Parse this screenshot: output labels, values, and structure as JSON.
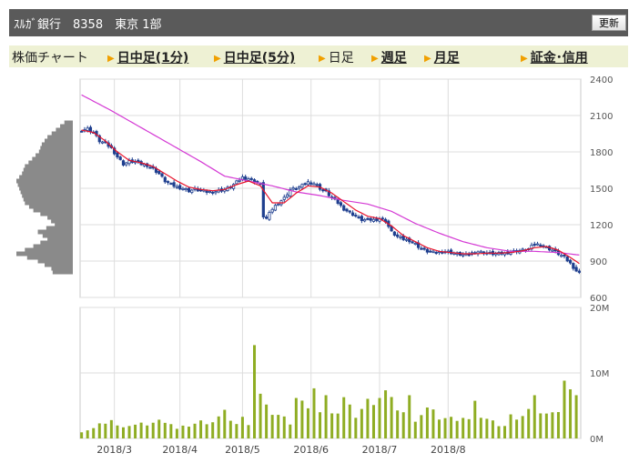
{
  "header": {
    "title": "ｽﾙｶﾞ銀行　8358　東京 1部",
    "refresh_label": "更新"
  },
  "tabs": {
    "chart_label": "株価チャート",
    "items": [
      {
        "label": "日中足(1分)",
        "link": true
      },
      {
        "label": "日中足(5分)",
        "link": true
      },
      {
        "label": "日足",
        "link": false
      },
      {
        "label": "週足",
        "link": true
      },
      {
        "label": "月足",
        "link": true
      },
      {
        "label": "証金･信用",
        "link": true
      }
    ]
  },
  "colors": {
    "candle_up": "#ffffff",
    "candle_down": "#1f3f8f",
    "ma_short": "#e8132b",
    "ma_long": "#d439d4",
    "volume_bar": "#8fad23",
    "volume_profile": "#8a8a8a"
  },
  "chart_data": {
    "type": "candlestick",
    "price_axis": {
      "min": 600,
      "max": 2400,
      "ticks": [
        600,
        900,
        1200,
        1500,
        1800,
        2100,
        2400
      ]
    },
    "volume_axis": {
      "min": 0,
      "max": 20,
      "ticks": [
        "0M",
        "10M",
        "20M"
      ]
    },
    "x_labels": [
      "2018/3",
      "2018/4",
      "2018/5",
      "2018/6",
      "2018/7",
      "2018/8"
    ],
    "price_anchors": [
      [
        0,
        1980
      ],
      [
        2,
        1990
      ],
      [
        4,
        1960
      ],
      [
        6,
        1890
      ],
      [
        8,
        1870
      ],
      [
        10,
        1830
      ],
      [
        12,
        1760
      ],
      [
        14,
        1700
      ],
      [
        16,
        1720
      ],
      [
        18,
        1720
      ],
      [
        20,
        1700
      ],
      [
        22,
        1690
      ],
      [
        24,
        1660
      ],
      [
        26,
        1620
      ],
      [
        28,
        1560
      ],
      [
        30,
        1530
      ],
      [
        32,
        1510
      ],
      [
        34,
        1500
      ],
      [
        36,
        1480
      ],
      [
        38,
        1490
      ],
      [
        40,
        1480
      ],
      [
        42,
        1470
      ],
      [
        44,
        1470
      ],
      [
        46,
        1480
      ],
      [
        48,
        1490
      ],
      [
        50,
        1510
      ],
      [
        52,
        1550
      ],
      [
        54,
        1590
      ],
      [
        56,
        1580
      ],
      [
        58,
        1560
      ],
      [
        60,
        1530
      ],
      [
        61,
        1270
      ],
      [
        62,
        1250
      ],
      [
        64,
        1330
      ],
      [
        66,
        1380
      ],
      [
        68,
        1420
      ],
      [
        70,
        1490
      ],
      [
        72,
        1500
      ],
      [
        74,
        1520
      ],
      [
        76,
        1550
      ],
      [
        78,
        1540
      ],
      [
        80,
        1500
      ],
      [
        82,
        1470
      ],
      [
        84,
        1420
      ],
      [
        86,
        1380
      ],
      [
        88,
        1330
      ],
      [
        90,
        1300
      ],
      [
        92,
        1270
      ],
      [
        94,
        1240
      ],
      [
        96,
        1240
      ],
      [
        98,
        1240
      ],
      [
        100,
        1250
      ],
      [
        102,
        1230
      ],
      [
        104,
        1140
      ],
      [
        106,
        1100
      ],
      [
        108,
        1080
      ],
      [
        110,
        1070
      ],
      [
        112,
        1040
      ],
      [
        114,
        1000
      ],
      [
        116,
        980
      ],
      [
        118,
        970
      ],
      [
        120,
        975
      ],
      [
        122,
        980
      ],
      [
        124,
        970
      ],
      [
        126,
        960
      ],
      [
        128,
        950
      ],
      [
        130,
        950
      ],
      [
        132,
        980
      ],
      [
        134,
        975
      ],
      [
        136,
        965
      ],
      [
        138,
        960
      ],
      [
        140,
        960
      ],
      [
        142,
        965
      ],
      [
        144,
        975
      ],
      [
        146,
        985
      ],
      [
        148,
        990
      ],
      [
        150,
        1000
      ],
      [
        152,
        1040
      ],
      [
        154,
        1035
      ],
      [
        156,
        1010
      ],
      [
        158,
        990
      ],
      [
        160,
        960
      ],
      [
        162,
        930
      ],
      [
        164,
        880
      ],
      [
        166,
        820
      ],
      [
        167,
        800
      ]
    ],
    "ma_short_anchors": [
      [
        0,
        1980
      ],
      [
        4,
        1960
      ],
      [
        8,
        1890
      ],
      [
        12,
        1800
      ],
      [
        16,
        1730
      ],
      [
        20,
        1710
      ],
      [
        24,
        1680
      ],
      [
        28,
        1620
      ],
      [
        32,
        1560
      ],
      [
        36,
        1510
      ],
      [
        40,
        1490
      ],
      [
        44,
        1480
      ],
      [
        48,
        1490
      ],
      [
        52,
        1530
      ],
      [
        56,
        1560
      ],
      [
        60,
        1520
      ],
      [
        64,
        1380
      ],
      [
        68,
        1380
      ],
      [
        72,
        1460
      ],
      [
        76,
        1520
      ],
      [
        80,
        1510
      ],
      [
        84,
        1460
      ],
      [
        88,
        1390
      ],
      [
        92,
        1320
      ],
      [
        96,
        1270
      ],
      [
        100,
        1250
      ],
      [
        104,
        1190
      ],
      [
        108,
        1110
      ],
      [
        112,
        1060
      ],
      [
        116,
        1010
      ],
      [
        120,
        980
      ],
      [
        124,
        970
      ],
      [
        128,
        960
      ],
      [
        132,
        960
      ],
      [
        136,
        965
      ],
      [
        140,
        965
      ],
      [
        144,
        970
      ],
      [
        148,
        985
      ],
      [
        152,
        1010
      ],
      [
        156,
        1020
      ],
      [
        160,
        990
      ],
      [
        164,
        930
      ],
      [
        167,
        880
      ]
    ],
    "ma_long_anchors": [
      [
        0,
        2270
      ],
      [
        10,
        2140
      ],
      [
        20,
        2000
      ],
      [
        30,
        1860
      ],
      [
        40,
        1720
      ],
      [
        48,
        1600
      ],
      [
        56,
        1560
      ],
      [
        64,
        1520
      ],
      [
        72,
        1470
      ],
      [
        80,
        1440
      ],
      [
        88,
        1400
      ],
      [
        96,
        1370
      ],
      [
        104,
        1310
      ],
      [
        112,
        1210
      ],
      [
        120,
        1130
      ],
      [
        128,
        1060
      ],
      [
        136,
        1010
      ],
      [
        144,
        980
      ],
      [
        152,
        980
      ],
      [
        160,
        970
      ],
      [
        167,
        950
      ]
    ],
    "volume_anchors": [
      [
        0,
        1.1
      ],
      [
        4,
        1.5
      ],
      [
        8,
        2.5
      ],
      [
        10,
        2.8
      ],
      [
        12,
        1.8
      ],
      [
        14,
        2.0
      ],
      [
        18,
        2.0
      ],
      [
        22,
        2.2
      ],
      [
        26,
        2.6
      ],
      [
        28,
        2.8
      ],
      [
        30,
        2.3
      ],
      [
        32,
        1.4
      ],
      [
        36,
        2.0
      ],
      [
        40,
        2.5
      ],
      [
        44,
        2.6
      ],
      [
        48,
        3.8
      ],
      [
        50,
        3.0
      ],
      [
        52,
        2.2
      ],
      [
        54,
        3.0
      ],
      [
        56,
        2.4
      ],
      [
        58,
        15.0
      ],
      [
        59,
        15.5
      ],
      [
        60,
        6.5
      ],
      [
        62,
        4.5
      ],
      [
        64,
        4.0
      ],
      [
        66,
        3.6
      ],
      [
        70,
        2.5
      ],
      [
        72,
        6.5
      ],
      [
        74,
        5.5
      ],
      [
        76,
        4.0
      ],
      [
        78,
        8.5
      ],
      [
        80,
        4.0
      ],
      [
        82,
        6.0
      ],
      [
        84,
        4.5
      ],
      [
        86,
        4.0
      ],
      [
        88,
        6.0
      ],
      [
        90,
        4.5
      ],
      [
        92,
        3.5
      ],
      [
        96,
        5.5
      ],
      [
        100,
        6.5
      ],
      [
        102,
        7.0
      ],
      [
        104,
        5.5
      ],
      [
        108,
        4.0
      ],
      [
        110,
        6.0
      ],
      [
        112,
        3.0
      ],
      [
        116,
        4.5
      ],
      [
        120,
        3.2
      ],
      [
        124,
        3.0
      ],
      [
        128,
        3.3
      ],
      [
        130,
        2.8
      ],
      [
        132,
        5.0
      ],
      [
        134,
        3.5
      ],
      [
        138,
        2.5
      ],
      [
        140,
        2.2
      ],
      [
        142,
        2.0
      ],
      [
        144,
        3.5
      ],
      [
        146,
        2.5
      ],
      [
        148,
        3.8
      ],
      [
        150,
        4.5
      ],
      [
        152,
        6.0
      ],
      [
        154,
        4.5
      ],
      [
        156,
        4.0
      ],
      [
        158,
        3.8
      ],
      [
        160,
        3.5
      ],
      [
        162,
        9.8
      ],
      [
        164,
        7.5
      ],
      [
        166,
        6.0
      ],
      [
        167,
        6.0
      ]
    ],
    "volume_profile_anchors": [
      [
        2040,
        0.15
      ],
      [
        1980,
        0.3
      ],
      [
        1920,
        0.45
      ],
      [
        1860,
        0.55
      ],
      [
        1800,
        0.6
      ],
      [
        1740,
        0.72
      ],
      [
        1680,
        0.85
      ],
      [
        1620,
        0.9
      ],
      [
        1560,
        1.0
      ],
      [
        1500,
        0.95
      ],
      [
        1440,
        0.9
      ],
      [
        1380,
        0.85
      ],
      [
        1320,
        0.7
      ],
      [
        1260,
        0.45
      ],
      [
        1200,
        0.32
      ],
      [
        1140,
        0.62
      ],
      [
        1080,
        0.45
      ],
      [
        1020,
        0.7
      ],
      [
        960,
        1.0
      ],
      [
        900,
        0.62
      ],
      [
        840,
        0.38
      ],
      [
        800,
        0.35
      ]
    ]
  }
}
